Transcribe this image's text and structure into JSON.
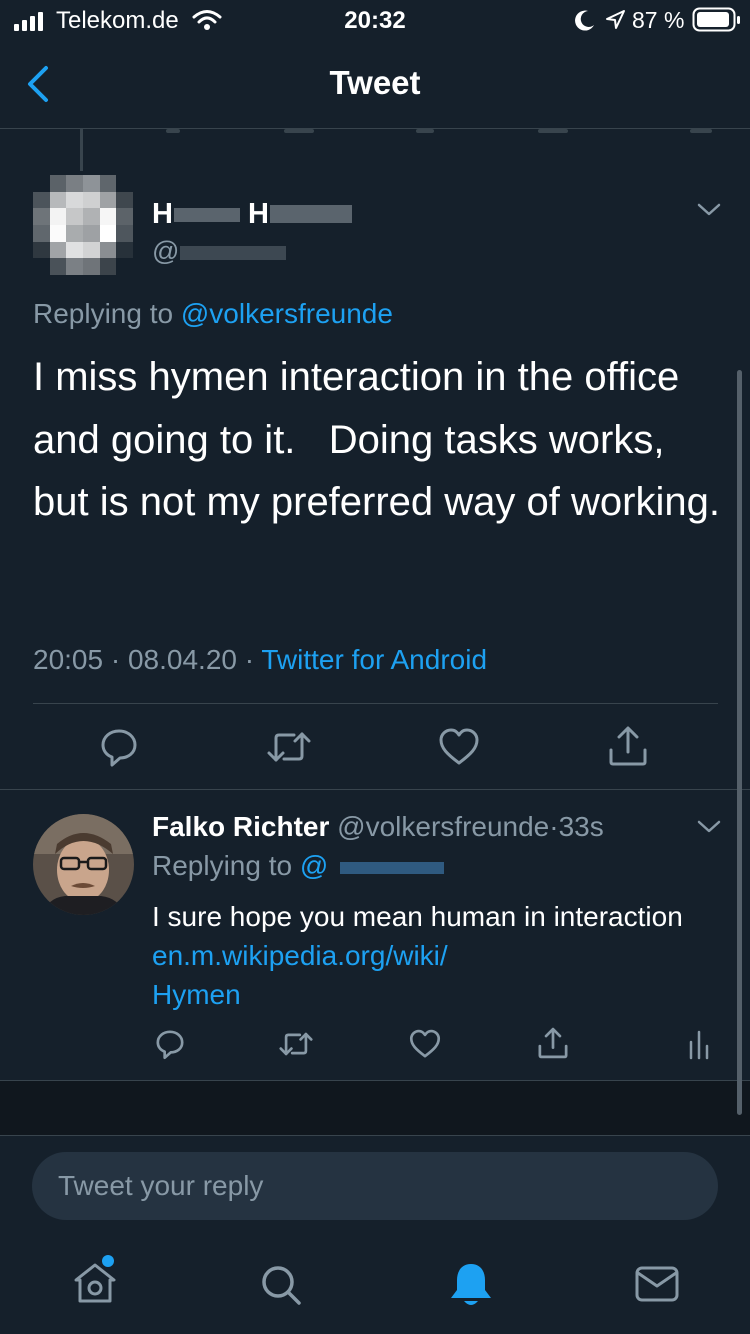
{
  "status_bar": {
    "carrier": "Telekom.de",
    "time": "20:32",
    "battery_percent": "87 %"
  },
  "nav": {
    "title": "Tweet",
    "back_icon": "chevron-left-icon"
  },
  "main_tweet": {
    "display_name_fragments": [
      "H",
      "H"
    ],
    "handle_prefix": "@",
    "replying_prefix": "Replying to",
    "replying_to": "@volkersfreunde",
    "text": "I miss hymen interaction in the office and going to it.   Doing tasks works, but is not my preferred way of working.",
    "time": "20:05",
    "separator": "·",
    "date": "08.04.20",
    "client": "Twitter for Android",
    "actions": [
      "reply-icon",
      "retweet-icon",
      "like-icon",
      "share-icon"
    ]
  },
  "reply_tweet": {
    "display_name": "Falko Richter",
    "handle": "@volkersfreunde",
    "separator": "·",
    "age": "33s",
    "replying_prefix": "Replying to",
    "replying_to_prefix": "@",
    "text": "I sure hope you mean human in interaction",
    "link_line1": "en.m.wikipedia.org/wiki/",
    "link_line2": "Hymen",
    "actions": [
      "reply-icon",
      "retweet-icon",
      "like-icon",
      "share-icon",
      "analytics-icon"
    ]
  },
  "composer": {
    "placeholder": "Tweet your reply"
  },
  "tab_bar": {
    "items": [
      "home-icon",
      "search-icon",
      "notifications-icon",
      "messages-icon"
    ],
    "active": "notifications-icon",
    "accent": "#1da1f2"
  },
  "colors": {
    "background": "#15202b",
    "accent": "#1da1f2",
    "muted": "#8899a6",
    "divider": "#38444d"
  }
}
